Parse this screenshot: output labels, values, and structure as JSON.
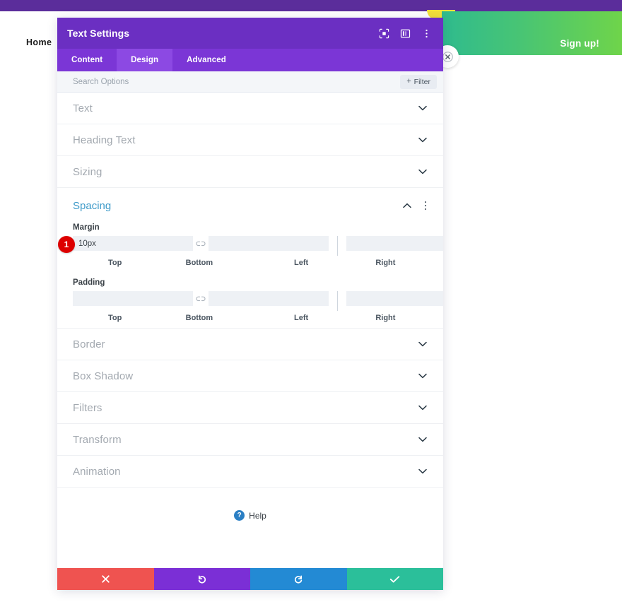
{
  "background": {
    "nav_home": "Home",
    "signup_label": "Sign up!",
    "close_icon": "close-circle-icon",
    "top_bar_color": "#5b2d9b",
    "banner_gradient_start": "#2fbb8e",
    "banner_gradient_end": "#6fd44a",
    "accent_yellow": "#f3e03b"
  },
  "panel": {
    "title": "Text Settings",
    "titlebar_color": "#6b2fc2",
    "title_icons": [
      {
        "name": "focus-target-icon"
      },
      {
        "name": "layout-columns-icon"
      },
      {
        "name": "vertical-dots-icon"
      }
    ],
    "tabs": [
      {
        "label": "Content",
        "active": false
      },
      {
        "label": "Design",
        "active": true
      },
      {
        "label": "Advanced",
        "active": false
      }
    ],
    "search": {
      "value": "",
      "placeholder": "Search Options",
      "filter_label": "Filter",
      "filter_plus": "+"
    },
    "sections": [
      {
        "label": "Text",
        "open": false
      },
      {
        "label": "Heading Text",
        "open": false
      },
      {
        "label": "Sizing",
        "open": false
      }
    ],
    "spacing": {
      "label": "Spacing",
      "accent_color": "#3f9bc9",
      "margin": {
        "label": "Margin",
        "top": {
          "value": "10px",
          "placeholder": "",
          "sublabel": "Top"
        },
        "bottom": {
          "value": "",
          "placeholder": "",
          "sublabel": "Bottom"
        },
        "left": {
          "value": "",
          "placeholder": "",
          "sublabel": "Left"
        },
        "right": {
          "value": "",
          "placeholder": "",
          "sublabel": "Right"
        },
        "link_icon": "chain-broken-icon"
      },
      "padding": {
        "label": "Padding",
        "top": {
          "value": "",
          "placeholder": "",
          "sublabel": "Top"
        },
        "bottom": {
          "value": "",
          "placeholder": "",
          "sublabel": "Bottom"
        },
        "left": {
          "value": "",
          "placeholder": "",
          "sublabel": "Left"
        },
        "right": {
          "value": "",
          "placeholder": "",
          "sublabel": "Right"
        },
        "link_icon": "chain-broken-icon"
      }
    },
    "sections_after": [
      {
        "label": "Border",
        "open": false
      },
      {
        "label": "Box Shadow",
        "open": false
      },
      {
        "label": "Filters",
        "open": false
      },
      {
        "label": "Transform",
        "open": false
      },
      {
        "label": "Animation",
        "open": false
      }
    ],
    "help": {
      "label": "Help",
      "badge": "?"
    },
    "footer": [
      {
        "name": "cancel-button",
        "icon": "x-icon",
        "color": "#ef5350"
      },
      {
        "name": "undo-button",
        "icon": "undo-icon",
        "color": "#7b2fd6"
      },
      {
        "name": "redo-button",
        "icon": "redo-icon",
        "color": "#238ad4"
      },
      {
        "name": "save-button",
        "icon": "check-icon",
        "color": "#2bbf9a"
      }
    ]
  },
  "annotations": {
    "marker_1": "1"
  }
}
